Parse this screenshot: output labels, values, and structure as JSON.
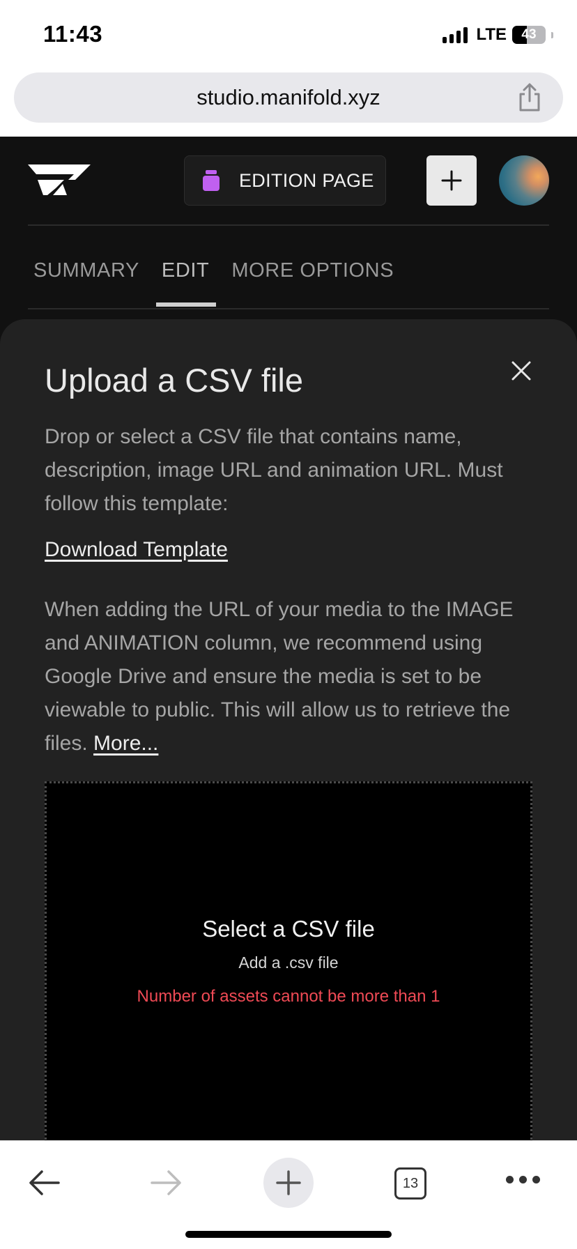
{
  "status_bar": {
    "time": "11:43",
    "network": "LTE",
    "battery_level": "43",
    "battery_fraction": 0.43
  },
  "browser": {
    "url": "studio.manifold.xyz",
    "share_icon": "share-icon",
    "tab_count": "13"
  },
  "header": {
    "logo": "manifold-logo",
    "edition_button_label": "EDITION PAGE",
    "edition_icon": "jar-icon",
    "edition_icon_color": "#c060f0",
    "add_icon": "plus-icon",
    "avatar": "avatar"
  },
  "tabs": [
    {
      "label": "SUMMARY",
      "active": false
    },
    {
      "label": "EDIT",
      "active": true
    },
    {
      "label": "MORE OPTIONS",
      "active": false
    }
  ],
  "modal": {
    "title": "Upload a CSV file",
    "description": "Drop or select a CSV file that contains name, description, image URL and animation URL. Must follow this template:",
    "download_link": "Download Template",
    "note": "When adding the URL of your media to the IMAGE and ANIMATION column, we recommend using Google Drive and ensure the media is set to be viewable to public. This will allow us to retrieve the files.",
    "more_link": "More...",
    "dropzone": {
      "title": "Select a CSV file",
      "subtitle": "Add a .csv file",
      "error": "Number of assets cannot be more than 1",
      "error_color": "#ef4a55"
    }
  }
}
